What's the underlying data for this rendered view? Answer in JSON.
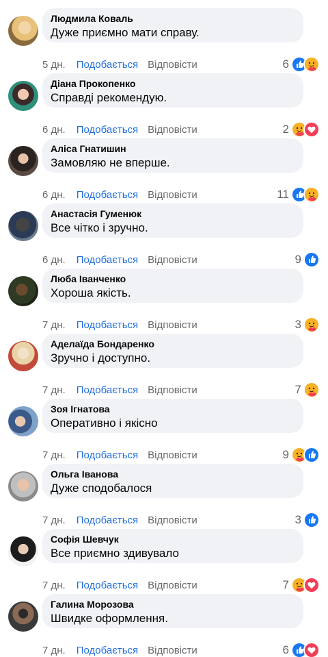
{
  "actions": {
    "like_label": "Подобається",
    "reply_label": "Відповісти"
  },
  "colors": {
    "bubble": "#f0f2f5",
    "link_blue": "#216fdb",
    "meta_gray": "#65676b",
    "like_blue": "#1877f2",
    "love_red": "#f33e58",
    "care_yellow": "#f7b125"
  },
  "comments": [
    {
      "author": "Людмила Коваль",
      "text": "Дуже приємно мати справу.",
      "time": "5 дн.",
      "count": "6",
      "reactions": [
        "like-icon",
        "care-icon"
      ]
    },
    {
      "author": "Діана Прокопенко",
      "text": "Справді рекомендую.",
      "time": "6 дн.",
      "count": "2",
      "reactions": [
        "care-icon",
        "love-icon"
      ]
    },
    {
      "author": "Аліса Гнатишин",
      "text": "Замовляю не вперше.",
      "time": "6 дн.",
      "count": "11",
      "reactions": [
        "like-icon",
        "care-icon"
      ]
    },
    {
      "author": "Анастасія Гуменюк",
      "text": "Все чітко і зручно.",
      "time": "6 дн.",
      "count": "9",
      "reactions": [
        "like-icon"
      ]
    },
    {
      "author": "Люба Іванченко",
      "text": "Хороша якість.",
      "time": "7 дн.",
      "count": "3",
      "reactions": [
        "care-icon"
      ]
    },
    {
      "author": "Аделаїда Бондаренко",
      "text": "Зручно і доступно.",
      "time": "7 дн.",
      "count": "7",
      "reactions": [
        "care-icon"
      ]
    },
    {
      "author": "Зоя Ігнатова",
      "text": "Оперативно і якісно",
      "time": "7 дн.",
      "count": "9",
      "reactions": [
        "care-icon",
        "like-icon"
      ]
    },
    {
      "author": "Ольга Іванова",
      "text": "Дуже сподобалося",
      "time": "7 дн.",
      "count": "3",
      "reactions": [
        "like-icon"
      ]
    },
    {
      "author": "Софія Шевчук",
      "text": "Все приємно здивувало",
      "time": "7 дн.",
      "count": "7",
      "reactions": [
        "care-icon",
        "love-icon"
      ]
    },
    {
      "author": "Галина Морозова",
      "text": "Швидке оформлення.",
      "time": "7 дн.",
      "count": "6",
      "reactions": [
        "like-icon",
        "love-icon"
      ]
    }
  ]
}
